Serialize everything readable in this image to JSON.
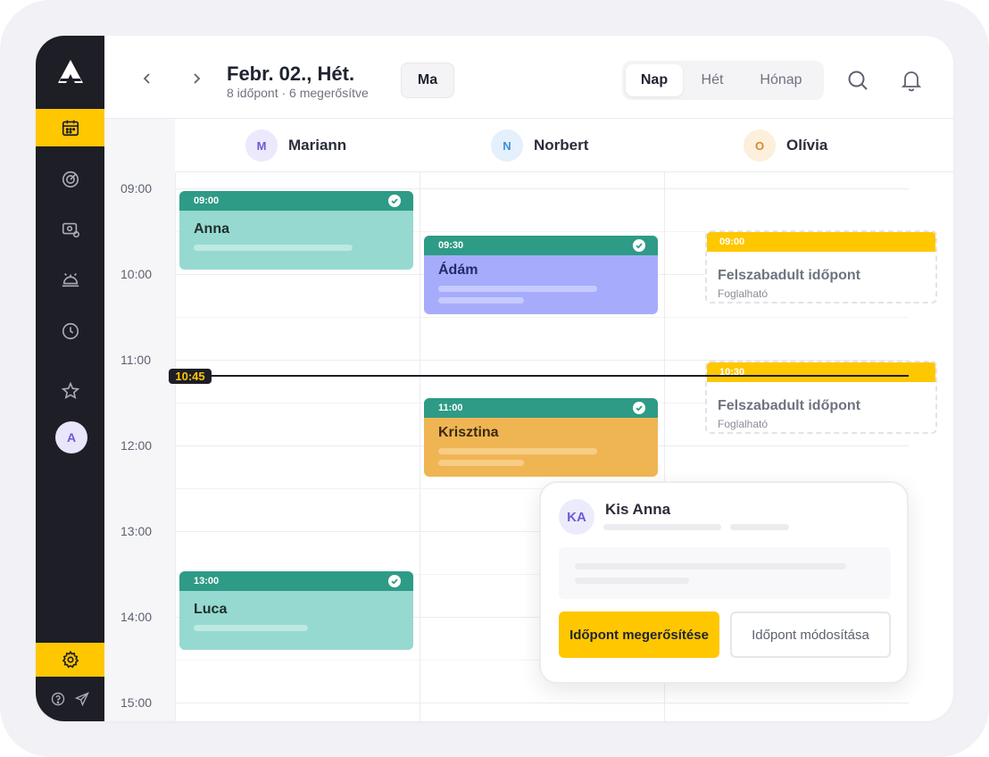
{
  "sidebar": {
    "logo": "logo-icon",
    "nav_icons": [
      "calendar-icon",
      "target-icon",
      "payment-icon",
      "service-bell-icon",
      "clock-icon",
      "star-icon"
    ],
    "user_initial": "A",
    "settings_icon": "gear-icon",
    "bottom_icons": [
      "help-icon",
      "send-icon"
    ]
  },
  "header": {
    "date_title": "Febr. 02., Hét.",
    "date_subtitle": "8 időpont · 6 megerősítve",
    "today_label": "Ma",
    "views": [
      "Nap",
      "Hét",
      "Hónap"
    ],
    "selected_view": "Nap"
  },
  "staff": [
    {
      "initial": "M",
      "name": "Mariann",
      "color": "#6b5bd6",
      "bg": "#ebe9fb"
    },
    {
      "initial": "N",
      "name": "Norbert",
      "color": "#3a8fd8",
      "bg": "#e4f0fb"
    },
    {
      "initial": "O",
      "name": "Olívia",
      "color": "#d98a2b",
      "bg": "#fcefdc"
    }
  ],
  "times": [
    "09:00",
    "10:00",
    "11:00",
    "12:00",
    "13:00",
    "14:00",
    "15:00"
  ],
  "current_time": "10:45",
  "appointments": [
    {
      "time": "09:00",
      "name": "Anna",
      "confirmed": true
    },
    {
      "time": "09:30",
      "name": "Ádám",
      "confirmed": true
    },
    {
      "time": "11:00",
      "name": "Krisztina",
      "confirmed": true
    },
    {
      "time": "13:00",
      "name": "Luca",
      "confirmed": true
    }
  ],
  "free_slots": [
    {
      "time": "09:00",
      "title": "Felszabadult időpont",
      "subtitle": "Foglalható"
    },
    {
      "time": "10:30",
      "title": "Felszabadult időpont",
      "subtitle": "Foglalható"
    }
  ],
  "popup": {
    "initials": "KA",
    "name": "Kis Anna",
    "confirm_label": "Időpont megerősítése",
    "modify_label": "Időpont módosítása"
  },
  "colors": {
    "accent": "#ffc700",
    "sidebar": "#1d1e26",
    "teal_header": "#2e9b86",
    "teal_body": "#96d9d0",
    "purple_body": "#a6acfb",
    "orange_body": "#f0b553"
  }
}
